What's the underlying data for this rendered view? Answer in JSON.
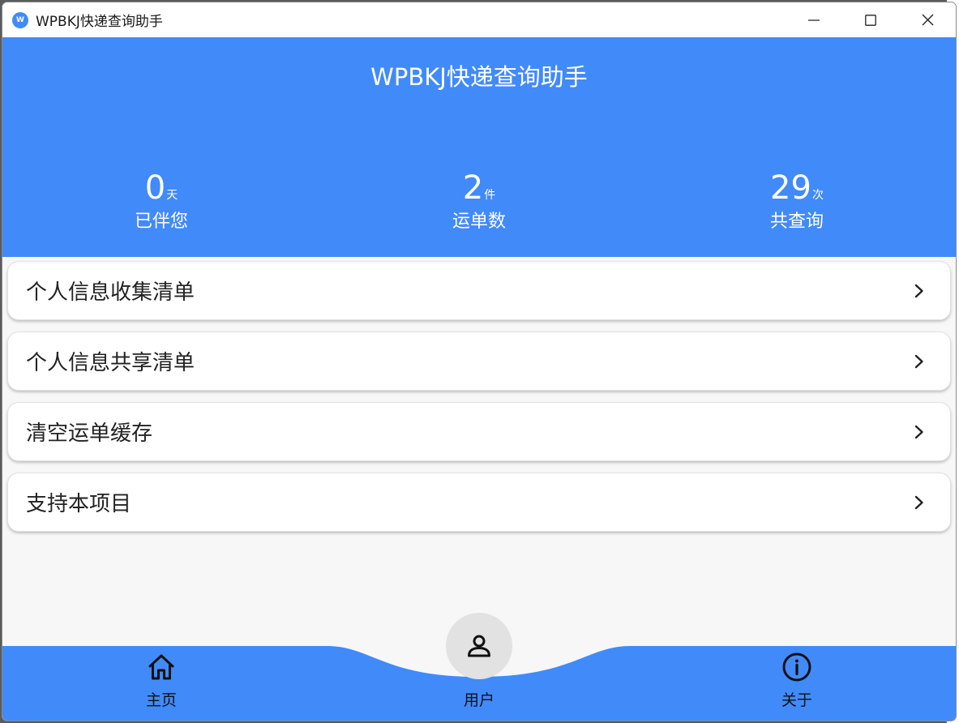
{
  "window": {
    "title": "WPBKJ快递查询助手",
    "controls": [
      "minimize-icon",
      "maximize-icon",
      "close-icon"
    ]
  },
  "header": {
    "title": "WPBKJ快递查询助手",
    "stats": [
      {
        "value": "0",
        "unit": "天",
        "label": "已伴您"
      },
      {
        "value": "2",
        "unit": "件",
        "label": "运单数"
      },
      {
        "value": "29",
        "unit": "次",
        "label": "共查询"
      }
    ]
  },
  "menu": [
    {
      "label": "个人信息收集清单",
      "icon": "chevron-right-icon"
    },
    {
      "label": "个人信息共享清单",
      "icon": "chevron-right-icon"
    },
    {
      "label": "清空运单缓存",
      "icon": "chevron-right-icon"
    },
    {
      "label": "支持本项目",
      "icon": "chevron-right-icon"
    }
  ],
  "bottom_nav": {
    "items": [
      {
        "label": "主页",
        "icon": "home-icon"
      },
      {
        "label": "用户",
        "icon": "user-icon",
        "active": true
      },
      {
        "label": "关于",
        "icon": "info-icon"
      }
    ]
  },
  "colors": {
    "accent": "#418af9",
    "background": "#f7f7f7",
    "card": "#ffffff",
    "fab": "#e2e2e2"
  }
}
